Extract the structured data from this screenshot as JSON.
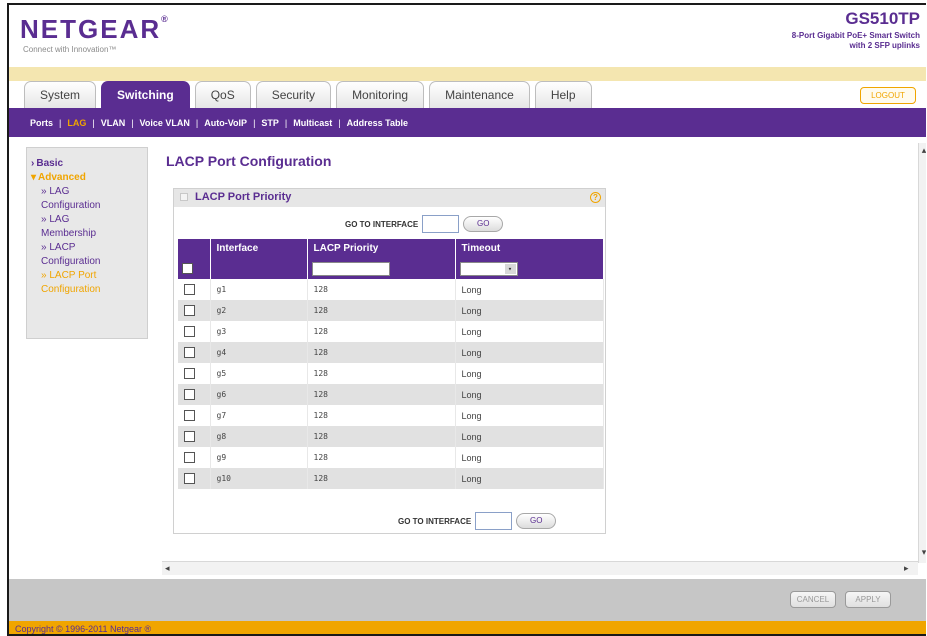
{
  "header": {
    "logo": "NETGEAR",
    "logo_mark": "®",
    "tagline": "Connect with Innovation™",
    "model": "GS510TP",
    "model_desc_1": "8-Port Gigabit PoE+ Smart Switch",
    "model_desc_2": "with 2 SFP uplinks",
    "logout": "LOGOUT"
  },
  "tabs": [
    {
      "label": "System"
    },
    {
      "label": "Switching"
    },
    {
      "label": "QoS"
    },
    {
      "label": "Security"
    },
    {
      "label": "Monitoring"
    },
    {
      "label": "Maintenance"
    },
    {
      "label": "Help"
    }
  ],
  "subnav": [
    "Ports",
    "LAG",
    "VLAN",
    "Voice VLAN",
    "Auto-VoIP",
    "STP",
    "Multicast",
    "Address Table"
  ],
  "leftnav": {
    "basic": "Basic",
    "advanced": "Advanced",
    "items": [
      {
        "line1": "LAG",
        "line2": "Configuration"
      },
      {
        "line1": "LAG",
        "line2": "Membership"
      },
      {
        "line1": "LACP",
        "line2": "Configuration"
      },
      {
        "line1": "LACP Port",
        "line2": "Configuration"
      }
    ]
  },
  "page_title": "LACP Port Configuration",
  "panel": {
    "title": "LACP Port Priority",
    "help": "?",
    "goto_label": "GO TO INTERFACE",
    "go_button": "GO",
    "columns": [
      "Interface",
      "LACP Priority",
      "Timeout"
    ],
    "select_arrow": "▾",
    "rows": [
      {
        "interface": "g1",
        "priority": "128",
        "timeout": "Long"
      },
      {
        "interface": "g2",
        "priority": "128",
        "timeout": "Long"
      },
      {
        "interface": "g3",
        "priority": "128",
        "timeout": "Long"
      },
      {
        "interface": "g4",
        "priority": "128",
        "timeout": "Long"
      },
      {
        "interface": "g5",
        "priority": "128",
        "timeout": "Long"
      },
      {
        "interface": "g6",
        "priority": "128",
        "timeout": "Long"
      },
      {
        "interface": "g7",
        "priority": "128",
        "timeout": "Long"
      },
      {
        "interface": "g8",
        "priority": "128",
        "timeout": "Long"
      },
      {
        "interface": "g9",
        "priority": "128",
        "timeout": "Long"
      },
      {
        "interface": "g10",
        "priority": "128",
        "timeout": "Long"
      }
    ]
  },
  "footer": {
    "cancel": "CANCEL",
    "apply": "APPLY",
    "copyright": "Copyright © 1996-2011 Netgear ®"
  },
  "colors": {
    "brand_purple": "#5a2d91",
    "accent_orange": "#f0a500"
  }
}
